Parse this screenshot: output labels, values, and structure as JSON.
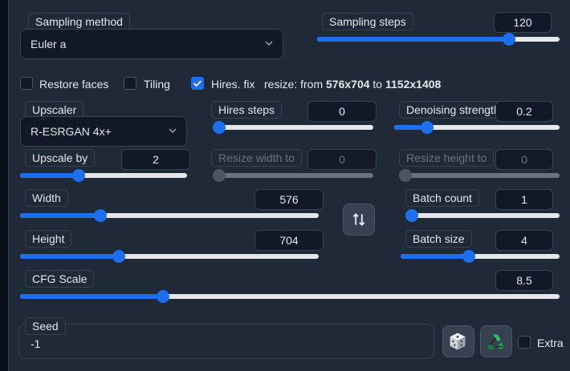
{
  "sampling": {
    "method_label": "Sampling method",
    "method_value": "Euler a",
    "steps_label": "Sampling steps",
    "steps_value": "120",
    "steps_fraction": 0.79
  },
  "options": {
    "restore_faces": {
      "label": "Restore faces",
      "checked": false
    },
    "tiling": {
      "label": "Tiling",
      "checked": false
    },
    "hires_fix": {
      "label": "Hires. fix",
      "checked": true
    },
    "resize_prefix": "resize: from ",
    "resize_from": "576x704",
    "resize_to_word": " to ",
    "resize_to": "1152x1408"
  },
  "hires": {
    "upscaler_label": "Upscaler",
    "upscaler_value": "R-ESRGAN 4x+",
    "hires_steps_label": "Hires steps",
    "hires_steps_value": "0",
    "hires_steps_fraction": 0.0,
    "denoise_label": "Denoising strength",
    "denoise_value": "0.2",
    "denoise_fraction": 0.2,
    "upscale_by_label": "Upscale by",
    "upscale_by_value": "2",
    "upscale_by_fraction": 0.35,
    "resize_width_label": "Resize width to",
    "resize_width_value": "0",
    "resize_width_fraction": 0.0,
    "resize_height_label": "Resize height to",
    "resize_height_value": "0",
    "resize_height_fraction": 0.0
  },
  "dims": {
    "width_label": "Width",
    "width_value": "576",
    "width_fraction": 0.27,
    "height_label": "Height",
    "height_value": "704",
    "height_fraction": 0.33,
    "swap_icon": "swap-vertical-icon"
  },
  "batch": {
    "count_label": "Batch count",
    "count_value": "1",
    "count_fraction": 0.0,
    "size_label": "Batch size",
    "size_value": "4",
    "size_fraction": 0.43
  },
  "cfg": {
    "label": "CFG Scale",
    "value": "8.5",
    "fraction": 0.265
  },
  "seed": {
    "label": "Seed",
    "value": "-1",
    "dice_icon": "dice-icon",
    "recycle_icon": "recycle-icon",
    "extra_label": "Extra",
    "extra_checked": false
  },
  "colors": {
    "accent": "#1d6ff2",
    "panel": "#1f2937",
    "input": "#111827",
    "border": "#374151"
  }
}
